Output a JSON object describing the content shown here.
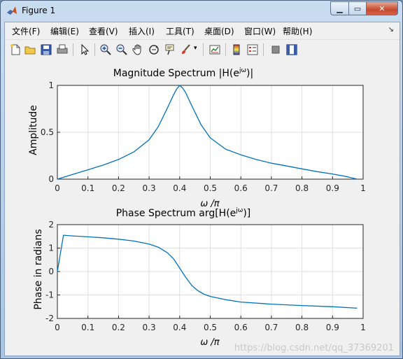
{
  "window": {
    "title": "Figure 1"
  },
  "menu": [
    "文件(F)",
    "编辑(E)",
    "查看(V)",
    "插入(I)",
    "工具(T)",
    "桌面(D)",
    "窗口(W)",
    "帮助(H)"
  ],
  "colors": {
    "line": "#0072bd",
    "grid": "#dfdfdf",
    "axes_bg": "#ffffff",
    "figure_bg": "#f0f0f0"
  },
  "watermark": "https://blog.csdn.net/qq_37369201",
  "chart_data": [
    {
      "type": "line",
      "title": "Magnitude Spectrum |H(e^jω)|",
      "title_main": "Magnitude Spectrum |H(e",
      "title_sup": "jω",
      "title_tail": ")|",
      "xlabel": "ω /π",
      "ylabel": "Amplitude",
      "xlim": [
        0,
        1
      ],
      "ylim": [
        0,
        1
      ],
      "xticks": [
        "0",
        "0.1",
        "0.2",
        "0.3",
        "0.4",
        "0.5",
        "0.6",
        "0.7",
        "0.8",
        "0.9",
        "1"
      ],
      "yticks": [
        "0",
        "0.5",
        "1"
      ],
      "grid": true,
      "series": [
        {
          "x": [
            0,
            0.05,
            0.1,
            0.15,
            0.2,
            0.25,
            0.3,
            0.33,
            0.36,
            0.38,
            0.39,
            0.4,
            0.41,
            0.42,
            0.44,
            0.47,
            0.5,
            0.55,
            0.6,
            0.65,
            0.7,
            0.75,
            0.8,
            0.85,
            0.9,
            0.95,
            0.98
          ],
          "y": [
            0.0,
            0.05,
            0.1,
            0.15,
            0.21,
            0.29,
            0.42,
            0.56,
            0.76,
            0.9,
            0.96,
            1.0,
            0.97,
            0.92,
            0.78,
            0.58,
            0.44,
            0.32,
            0.26,
            0.21,
            0.17,
            0.14,
            0.11,
            0.08,
            0.055,
            0.025,
            0.0
          ]
        }
      ]
    },
    {
      "type": "line",
      "title": "Phase Spectrum arg[H(e^jω)]",
      "title_main": "Phase Spectrum arg[H(e",
      "title_sup": "jω",
      "title_tail": ")]",
      "xlabel": "ω /π",
      "ylabel": "Phase in radians",
      "xlim": [
        0,
        1
      ],
      "ylim": [
        -2,
        2
      ],
      "xticks": [
        "0",
        "0.1",
        "0.2",
        "0.3",
        "0.4",
        "0.5",
        "0.6",
        "0.7",
        "0.8",
        "0.9",
        "1"
      ],
      "yticks": [
        "-2",
        "-1",
        "0",
        "1",
        "2"
      ],
      "grid": true,
      "series": [
        {
          "x": [
            0,
            0.02,
            0.05,
            0.1,
            0.15,
            0.2,
            0.25,
            0.3,
            0.33,
            0.36,
            0.38,
            0.4,
            0.42,
            0.44,
            0.46,
            0.48,
            0.5,
            0.55,
            0.6,
            0.7,
            0.8,
            0.9,
            0.98
          ],
          "y": [
            0,
            1.55,
            1.52,
            1.48,
            1.44,
            1.38,
            1.3,
            1.17,
            1.04,
            0.8,
            0.54,
            0.15,
            -0.25,
            -0.6,
            -0.82,
            -0.97,
            -1.06,
            -1.2,
            -1.3,
            -1.39,
            -1.45,
            -1.5,
            -1.56
          ]
        }
      ]
    }
  ]
}
